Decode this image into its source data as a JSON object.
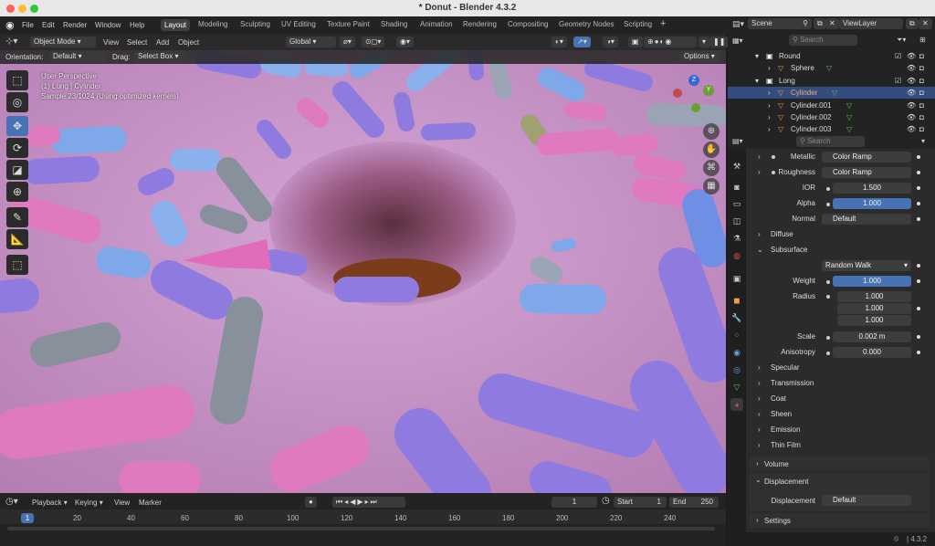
{
  "window": {
    "title": "* Donut - Blender 4.3.2"
  },
  "menu": [
    "File",
    "Edit",
    "Render",
    "Window",
    "Help"
  ],
  "workspaces": [
    "Layout",
    "Modeling",
    "Sculpting",
    "UV Editing",
    "Texture Paint",
    "Shading",
    "Animation",
    "Rendering",
    "Compositing",
    "Geometry Nodes",
    "Scripting"
  ],
  "active_workspace": "Layout",
  "viewport_header": {
    "mode": "Object Mode",
    "menus": [
      "View",
      "Select",
      "Add",
      "Object"
    ],
    "transform": "Global"
  },
  "tool_settings": {
    "orientation_label": "Orientation:",
    "orientation_value": "Default",
    "drag_label": "Drag:",
    "drag_value": "Select Box",
    "options": "Options"
  },
  "viewport_overlay": {
    "line1": "User Perspective",
    "line2": "(1) Long | Cylinder",
    "line3": "Sample 23/1024 (Using optimized kernels)"
  },
  "gizmo": {
    "z": "Z",
    "y": "Y"
  },
  "timeline": {
    "menus": [
      "Playback",
      "Keying",
      "View",
      "Marker"
    ],
    "current_frame": "1",
    "start_label": "Start",
    "start": "1",
    "end_label": "End",
    "end": "250",
    "ruler": [
      "1",
      "20",
      "40",
      "60",
      "80",
      "100",
      "120",
      "140",
      "160",
      "180",
      "200",
      "220",
      "240"
    ]
  },
  "outliner": {
    "scene": "Scene",
    "view_layer": "ViewLayer",
    "search_placeholder": "Search",
    "rows": [
      {
        "label": "Round",
        "type": "collection"
      },
      {
        "label": "Sphere",
        "type": "object"
      },
      {
        "label": "Long",
        "type": "collection"
      },
      {
        "label": "Cylinder",
        "type": "object",
        "selected": true
      },
      {
        "label": "Cylinder.001",
        "type": "object"
      },
      {
        "label": "Cylinder.002",
        "type": "object"
      },
      {
        "label": "Cylinder.003",
        "type": "object"
      }
    ]
  },
  "properties": {
    "search_placeholder": "Search",
    "metallic_label": "Metallic",
    "metallic_value": "Color Ramp",
    "roughness_label": "Roughness",
    "roughness_value": "Color Ramp",
    "ior_label": "IOR",
    "ior_value": "1.500",
    "alpha_label": "Alpha",
    "alpha_value": "1.000",
    "normal_label": "Normal",
    "normal_value": "Default",
    "diffuse": "Diffuse",
    "subsurface": "Subsurface",
    "subsurface_method": "Random Walk",
    "weight_label": "Weight",
    "weight_value": "1.000",
    "radius_label": "Radius",
    "radius_values": [
      "1.000",
      "1.000",
      "1.000"
    ],
    "scale_label": "Scale",
    "scale_value": "0.002 m",
    "anisotropy_label": "Anisotropy",
    "anisotropy_value": "0.000",
    "specular": "Specular",
    "transmission": "Transmission",
    "coat": "Coat",
    "sheen": "Sheen",
    "emission": "Emission",
    "thin_film": "Thin Film",
    "volume": "Volume",
    "displacement": "Displacement",
    "displacement_label": "Displacement",
    "displacement_value": "Default",
    "settings": "Settings"
  },
  "status": {
    "version": "4.3.2"
  },
  "colors": {
    "accent": "#4772b3",
    "selected_row": "#334d80",
    "header": "#232323",
    "donut_icing": "#c58fc4"
  }
}
